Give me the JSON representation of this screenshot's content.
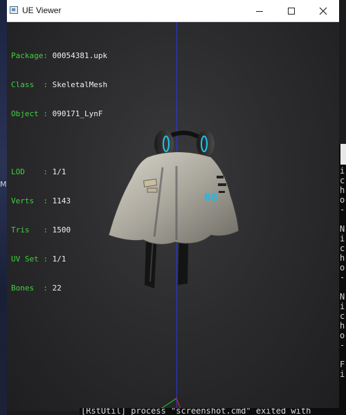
{
  "window": {
    "title": "UE Viewer",
    "controls": {
      "minimize": "minimize",
      "maximize": "maximize",
      "close": "close"
    }
  },
  "info": {
    "package_label": "Package:",
    "package_value": "00054381.upk",
    "class_label": "Class  :",
    "class_value": "SkeletalMesh",
    "object_label": "Object :",
    "object_value": "090171_LynF",
    "lod_label": "LOD    :",
    "lod_value": "1/1",
    "verts_label": "Verts  :",
    "verts_value": "1143",
    "tris_label": "Tris   :",
    "tris_value": "1500",
    "uvset_label": "UV Set :",
    "uvset_value": "1/1",
    "bones_label": "Bones  :",
    "bones_value": "22"
  },
  "background": {
    "desktop_left_text": "M",
    "console_right_lines": [
      "i",
      "c",
      "h",
      "o",
      "-",
      "",
      "N",
      "i",
      "c",
      "h",
      "o",
      "-",
      "",
      "N",
      "i",
      "c",
      "h",
      "o",
      "-",
      "",
      "F",
      "i"
    ],
    "console_bottom_text": "[RstUtil] process \"screenshot.cmd\" exited with"
  },
  "colors": {
    "label_green": "#3fd13f",
    "axis_blue": "#2a36d9",
    "axis_green": "#1fb81f",
    "axis_red": "#d42020"
  }
}
